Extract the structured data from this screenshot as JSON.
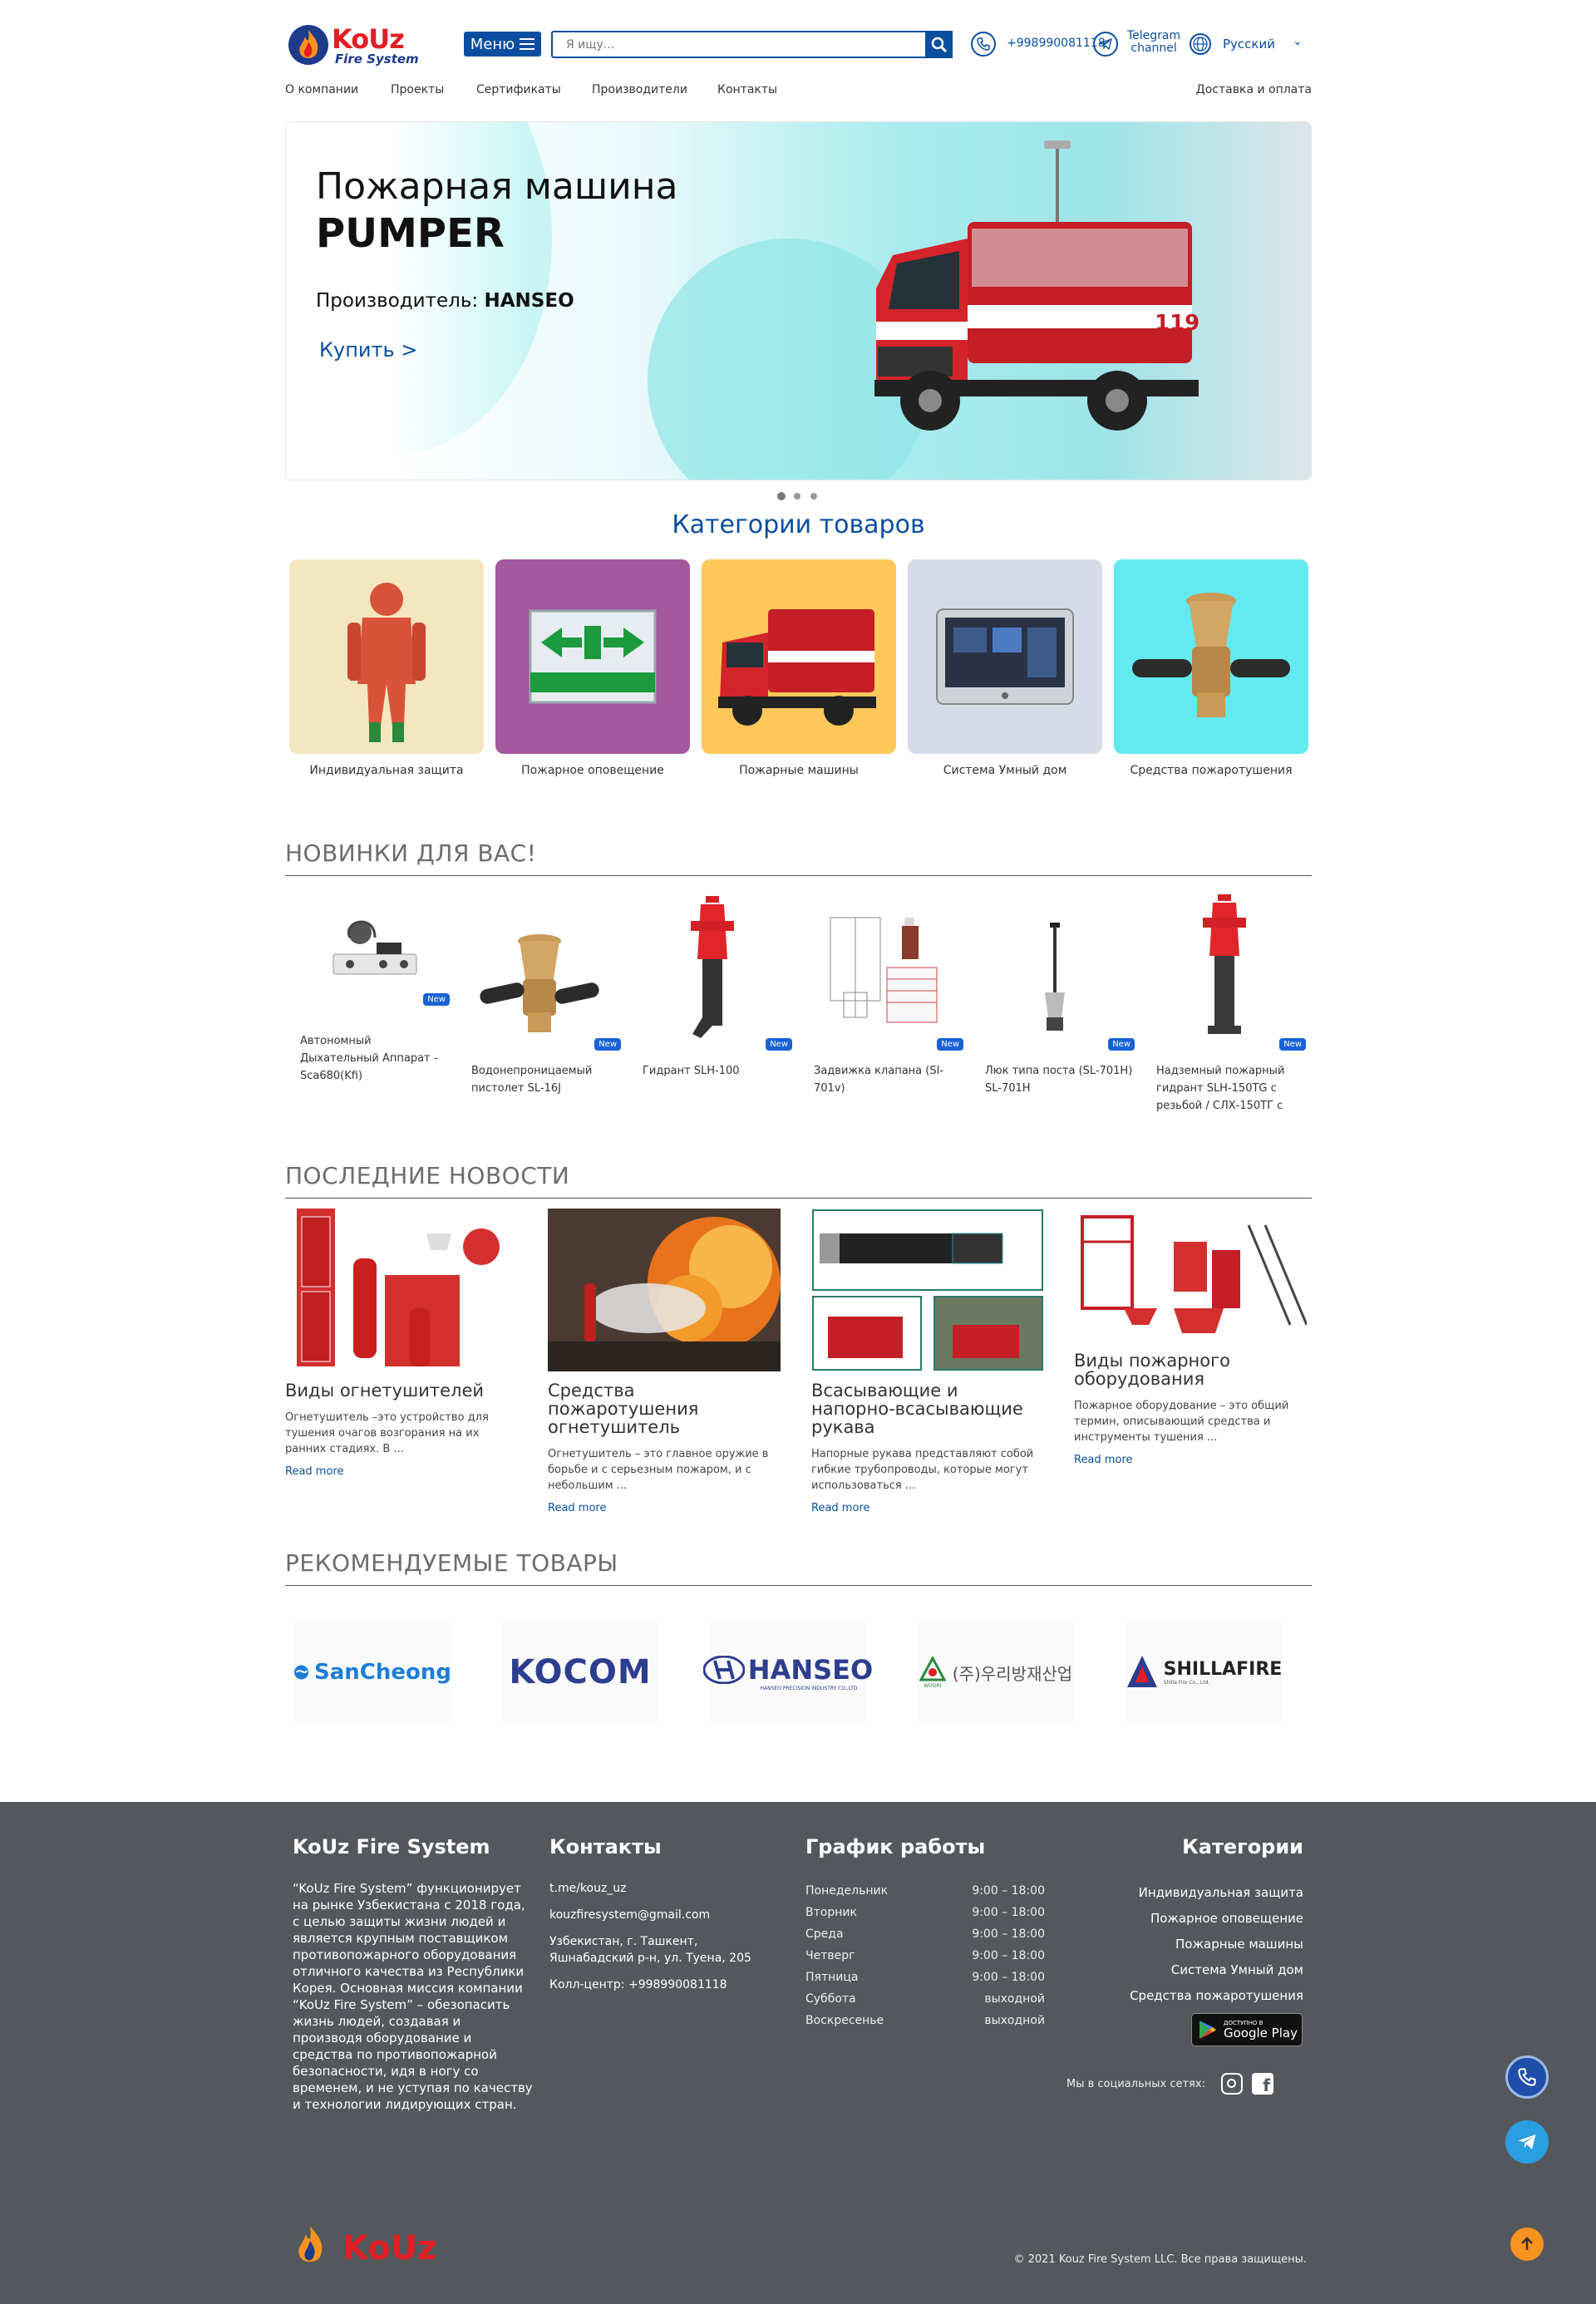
{
  "header": {
    "logo_name": "KoUz",
    "logo_sub": "Fire System",
    "menu_label": "Меню",
    "search_placeholder": "Я ищу...",
    "phone": "+998990081118",
    "telegram_line1": "Telegram",
    "telegram_line2": "channel",
    "language": "Русский"
  },
  "nav": {
    "items": [
      "О компании",
      "Проекты",
      "Сертификаты",
      "Производители",
      "Контакты"
    ],
    "right": "Доставка и оплата"
  },
  "hero": {
    "title_line1": "Пожарная машина",
    "title_line2": "PUMPER",
    "maker_label": "Производитель:",
    "maker_name": "HANSEO",
    "buy_label": "Купить >",
    "slides_count": 3,
    "active_slide": 1
  },
  "categories": {
    "title": "Категории товаров",
    "items": [
      {
        "label": "Индивидуальная защита",
        "bg": "#f4e6bf",
        "icon": "protective-suit"
      },
      {
        "label": "Пожарное оповещение",
        "bg": "#a4589e",
        "icon": "exit-sign"
      },
      {
        "label": "Пожарные машины",
        "bg": "#fdc85a",
        "icon": "fire-truck"
      },
      {
        "label": "Система Умный дом",
        "bg": "#d5dce7",
        "icon": "smart-panel"
      },
      {
        "label": "Средства пожаротушения",
        "bg": "#62eaf0",
        "icon": "nozzle"
      }
    ]
  },
  "new_products": {
    "title": "НОВИНКИ ДЛЯ ВАС!",
    "badge": "New",
    "items": [
      {
        "name": "Автономный Дыхательный Аппарат - Sca680(Kfi)"
      },
      {
        "name": "Водонепроницаемый пистолет SL-16J"
      },
      {
        "name": "Гидрант SLH-100"
      },
      {
        "name": "Задвижка клапана (SI-701v)"
      },
      {
        "name": "Люк типа поста (SL-701H) SL-701H"
      },
      {
        "name": "Надземный пожарный гидрант SLH-150TG с резьбой / СЛХ-150ТГ с"
      }
    ]
  },
  "news": {
    "title": "ПОСЛЕДНИЕ НОВОСТИ",
    "read_more": "Read more",
    "items": [
      {
        "title": "Виды огнетушителей",
        "text": "Огнетушитель –это устройство для тушения очагов возгорания на их ранних стадиях. В ..."
      },
      {
        "title": "Средства пожаротушения огнетушитель",
        "text": "Огнетушитель – это главное оружие в борьбе и с серьезным пожаром, и с небольшим ..."
      },
      {
        "title": "Всасывающие и напорно-всасывающие рукава",
        "text": "Напорные рукава представляют собой гибкие трубопроводы, которые могут использоваться ..."
      },
      {
        "title": "Виды пожарного оборудования",
        "text": "Пожарное оборудование – это общий термин, описывающий средства и инструменты тушения ..."
      }
    ]
  },
  "recommended": {
    "title": "РЕКОМЕНДУЕМЫЕ ТОВАРЫ",
    "brands": [
      "SanCheong",
      "KOCOM",
      "HANSEO",
      "(주)우리방재산업",
      "SHILLAFIRE"
    ],
    "brand_subtitles": [
      "",
      "",
      "HANSEO PRECISION INDUSTRY CO.,LTD",
      "WOORI",
      "Shilla Fire Co., Ltd."
    ]
  },
  "footer": {
    "about_title": "KoUz Fire System",
    "about_text": "“KoUz Fire System” функционирует на рынке Узбекистана с 2018 года, с целью защиты жизни людей и является крупным поставщиком противопожарного оборудования отличного качества из Республики Корея. Основная миссия компании “KoUz Fire System” – обезопасить жизнь людей, создавая и производя оборудование и средства по противопожарной безопасности, идя в ногу со временем, и не уступая по качеству и технологии лидирующих стран.",
    "contacts_title": "Контакты",
    "contacts": {
      "telegram": "t.me/kouz_uz",
      "email": "kouzfiresystem@gmail.com",
      "address": "Узбекистан, г. Ташкент, Яшнабадский р-н, ул. Туена, 205",
      "callcenter": "Колл-центр: +998990081118"
    },
    "schedule_title": "График работы",
    "schedule": [
      {
        "day": "Понедельник",
        "hours": "9:00 – 18:00"
      },
      {
        "day": "Вторник",
        "hours": "9:00 – 18:00"
      },
      {
        "day": "Среда",
        "hours": "9:00 – 18:00"
      },
      {
        "day": "Четверг",
        "hours": "9:00 – 18:00"
      },
      {
        "day": "Пятница",
        "hours": "9:00 – 18:00"
      },
      {
        "day": "Суббота",
        "hours": "выходной"
      },
      {
        "day": "Воскресенье",
        "hours": "выходной"
      }
    ],
    "categories_title": "Категории",
    "categories": [
      "Индивидуальная защита",
      "Пожарное оповещение",
      "Пожарные машины",
      "Система Умный дом",
      "Средства пожаротушения"
    ],
    "google_play_small": "ДОСТУПНО В",
    "google_play": "Google Play",
    "social_label": "Мы в социальных сетях:",
    "copyright": "© 2021 Kouz Fire System LLC. Все права защищены."
  },
  "colors": {
    "primary": "#0a4ea0",
    "brand_red": "#e31e24",
    "footer_bg": "#54585c",
    "badge": "#1a62d6",
    "scroll_top": "#f7931e"
  }
}
